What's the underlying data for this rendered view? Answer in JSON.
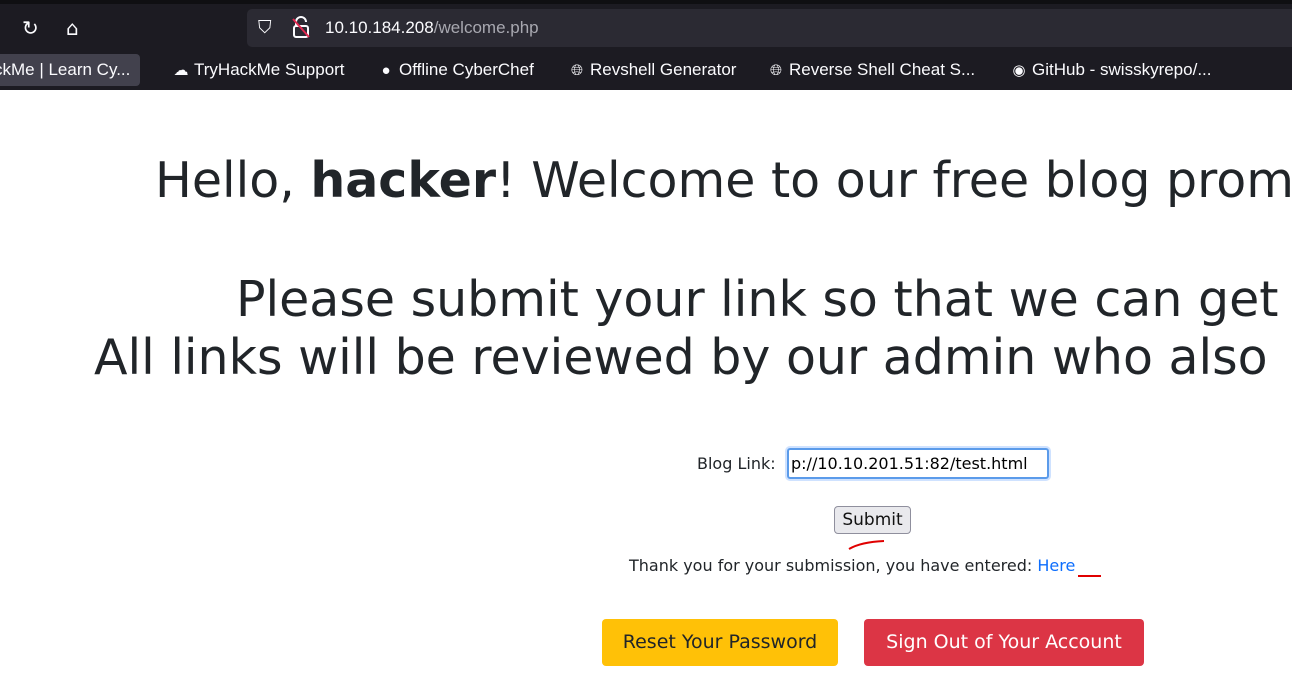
{
  "browser": {
    "url_host": "10.10.184.208",
    "url_path": "/welcome.php",
    "bookmarks": [
      {
        "label": "ckMe | Learn Cy...",
        "icon": "tryhackme-icon"
      },
      {
        "label": "TryHackMe Support",
        "icon": "cloud-support-icon"
      },
      {
        "label": "Offline CyberChef",
        "icon": "chef-hat-icon"
      },
      {
        "label": "Revshell Generator",
        "icon": "globe-icon"
      },
      {
        "label": "Reverse Shell Cheat S...",
        "icon": "globe-icon"
      },
      {
        "label": "GitHub - swisskyrepo/...",
        "icon": "github-icon"
      }
    ]
  },
  "page": {
    "greeting_prefix": "Hello, ",
    "greeting_user": "hacker",
    "greeting_suffix": "! Welcome to our free blog prom",
    "line2": "Please submit your link so that we can get",
    "line3": "All links will be reviewed by our admin who also",
    "blog_link_label": "Blog Link:",
    "blog_link_value": "p://10.10.201.51:82/test.html",
    "submit_label": "Submit",
    "confirmation_text": "Thank you for your submission, you have entered: ",
    "confirmation_link": "Here",
    "reset_password_label": "Reset Your Password",
    "sign_out_label": "Sign Out of Your Account"
  },
  "colors": {
    "warning": "#ffc107",
    "danger": "#dc3545",
    "link": "#0d6efd",
    "annotation": "#e00000"
  }
}
